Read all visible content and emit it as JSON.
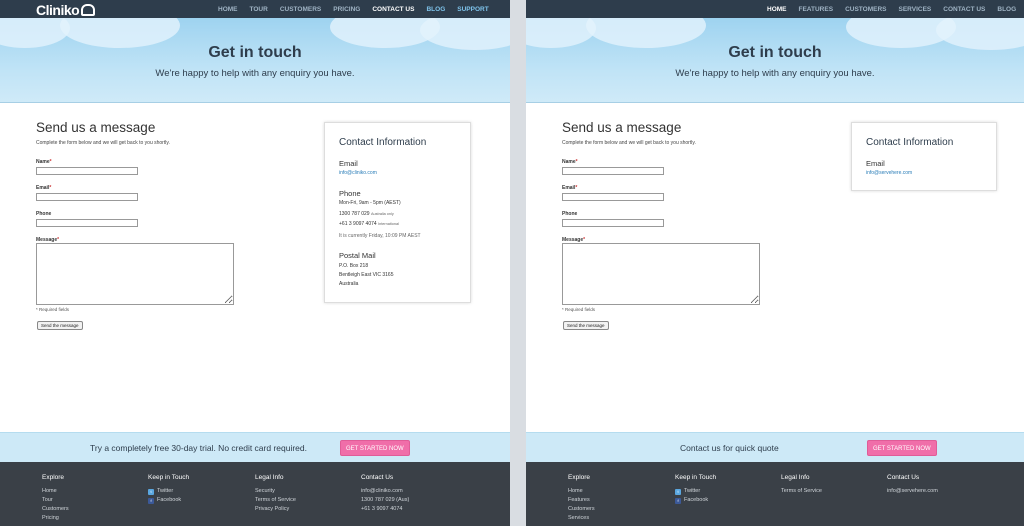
{
  "left": {
    "logo": "Cliniko",
    "nav": [
      "HOME",
      "TOUR",
      "CUSTOMERS",
      "PRICING",
      "CONTACT US",
      "BLOG",
      "SUPPORT"
    ],
    "hero": {
      "title": "Get in touch",
      "subtitle": "We're happy to help with any enquiry you have."
    },
    "form": {
      "title": "Send us a message",
      "desc": "Complete the form below and we will get back to you shortly.",
      "name_label": "Name",
      "email_label": "Email",
      "phone_label": "Phone",
      "message_label": "Message",
      "required_mark": "*",
      "required_note": "* Required fields",
      "submit": "Send the message"
    },
    "contact": {
      "title": "Contact Information",
      "email_h": "Email",
      "email": "info@cliniko.com",
      "phone_h": "Phone",
      "hours": "Mon-Fri, 9am - 5pm (AEST)",
      "phone1": "1300 787 029",
      "phone1_note": "Australia only",
      "phone2": "+61 3 9097 4074",
      "phone2_note": "International",
      "current": "It is currently Friday, 10:09 PM AEST",
      "postal_h": "Postal Mail",
      "postal1": "P.O. Box 218",
      "postal2": "Bentleigh East VIC 3165",
      "postal3": "Australia"
    },
    "cta": {
      "text": "Try a completely free 30-day trial. No credit card required.",
      "button": "GET STARTED NOW"
    },
    "footer": {
      "explore_h": "Explore",
      "explore": [
        "Home",
        "Tour",
        "Customers",
        "Pricing"
      ],
      "keep_h": "Keep in Touch",
      "twitter": "Twitter",
      "facebook": "Facebook",
      "legal_h": "Legal Info",
      "legal": [
        "Security",
        "Terms of Service",
        "Privacy Policy"
      ],
      "contact_h": "Contact Us",
      "contact": [
        "info@cliniko.com",
        "1300 787 029 (Aus)",
        "+61 3 9097 4074"
      ]
    }
  },
  "right": {
    "nav": [
      "HOME",
      "FEATURES",
      "CUSTOMERS",
      "SERVICES",
      "CONTACT US",
      "BLOG"
    ],
    "hero": {
      "title": "Get in touch",
      "subtitle": "We're happy to help with any enquiry you have."
    },
    "form": {
      "title": "Send us a message",
      "desc": "Complete the form below and we will get back to you shortly.",
      "name_label": "Name",
      "email_label": "Email",
      "phone_label": "Phone",
      "message_label": "Message",
      "required_mark": "*",
      "required_note": "* Required fields",
      "submit": "Send the message"
    },
    "contact": {
      "title": "Contact Information",
      "email_h": "Email",
      "email": "info@servehere.com"
    },
    "cta": {
      "text": "Contact us for quick quote",
      "button": "GET STARTED NOW"
    },
    "footer": {
      "explore_h": "Explore",
      "explore": [
        "Home",
        "Features",
        "Customers",
        "Services"
      ],
      "keep_h": "Keep in Touch",
      "twitter": "Twitter",
      "facebook": "Facebook",
      "legal_h": "Legal Info",
      "legal": [
        "Terms of Service"
      ],
      "contact_h": "Contact Us",
      "contact": [
        "info@servehere.com"
      ]
    }
  },
  "colors": {
    "topbar": "#2e3d4c",
    "hero": "#bfe3f6",
    "cta_button": "#f06ea9",
    "footer": "#3a4047",
    "link": "#2a7db8"
  },
  "icons": {
    "twitter": "twitter-icon",
    "facebook": "facebook-icon"
  }
}
